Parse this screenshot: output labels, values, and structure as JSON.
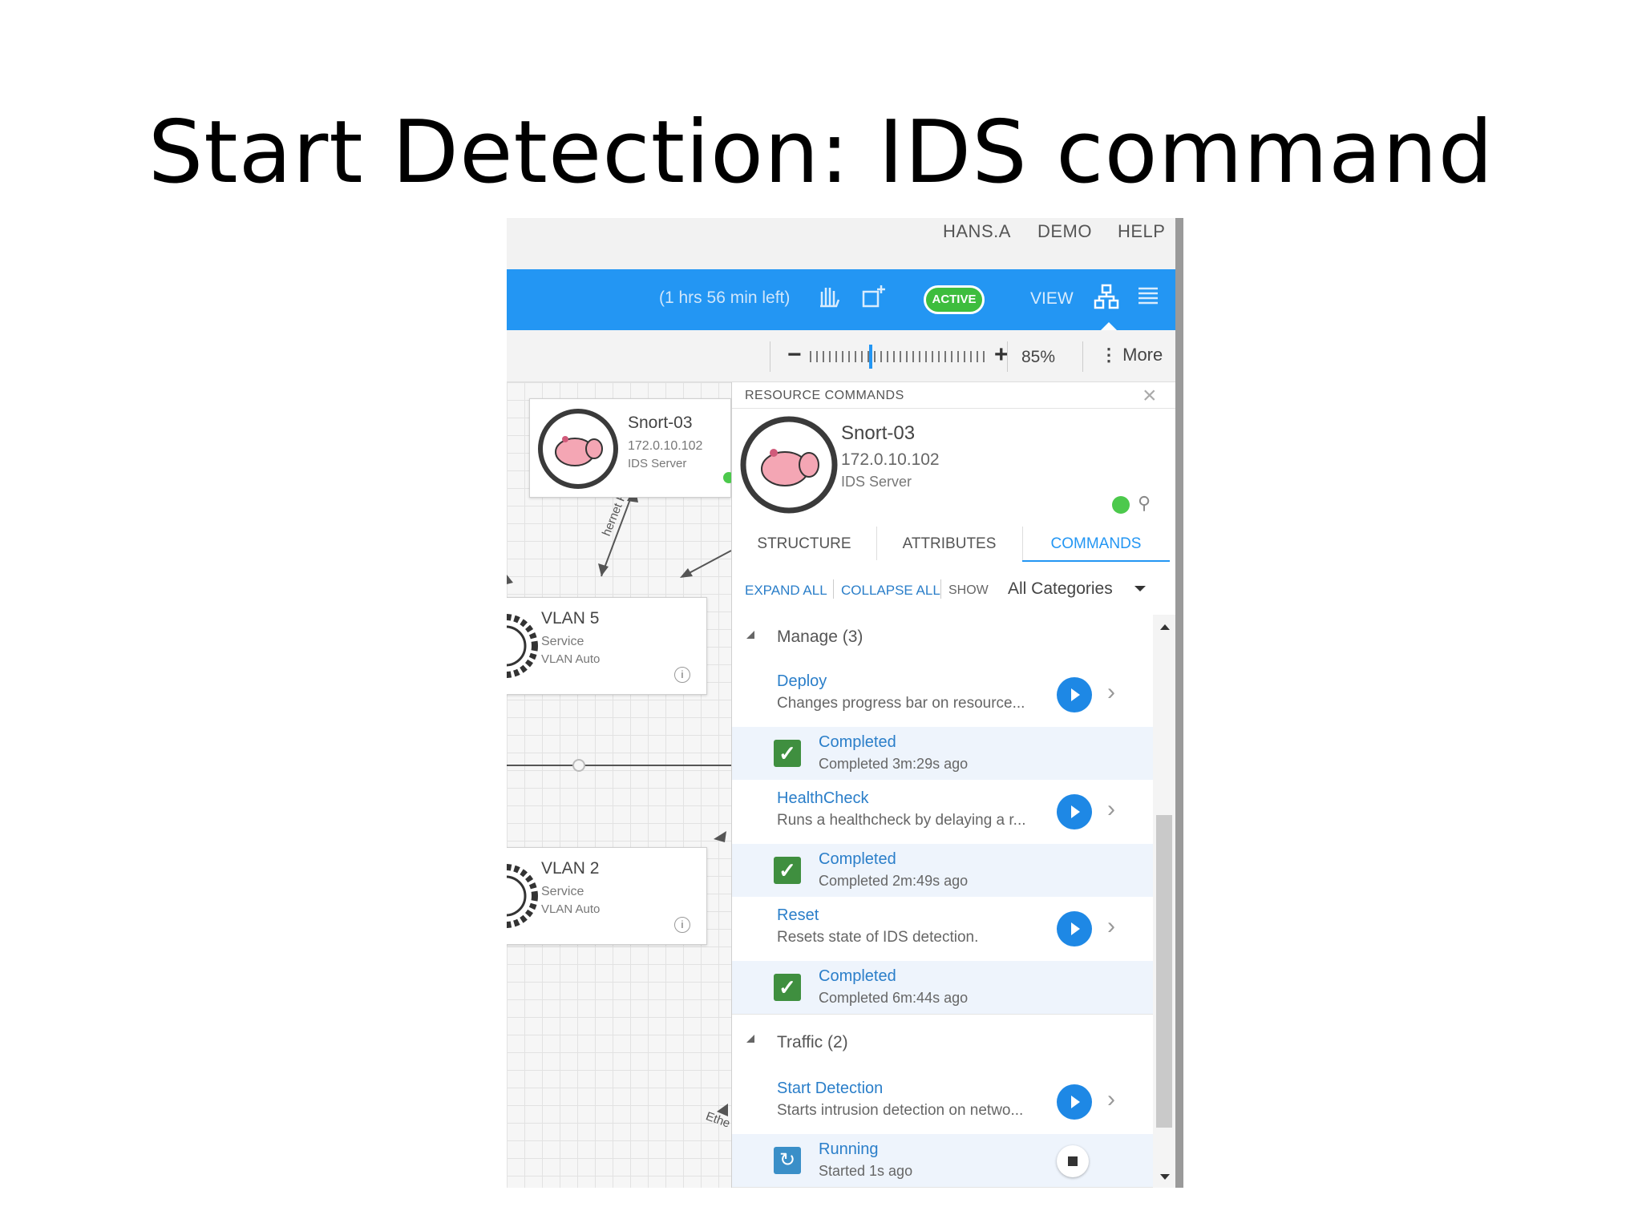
{
  "slide": {
    "title": "Start Detection: IDS command"
  },
  "topnav": {
    "user": "HANS.A",
    "demo": "DEMO",
    "help": "HELP"
  },
  "toolbar": {
    "time_left": "(1 hrs 56 min left)",
    "status": "ACTIVE",
    "view_label": "VIEW",
    "accent_color": "#2396f3"
  },
  "zoom": {
    "minus": "−",
    "plus": "+",
    "percent": "85%",
    "more": "More"
  },
  "canvas": {
    "snort_node": {
      "title": "Snort-03",
      "ip": "172.0.10.102",
      "type": "IDS Server"
    },
    "vlan5": {
      "title": "VLAN 5",
      "sub1": "Service",
      "sub2": "VLAN Auto"
    },
    "vlan2": {
      "title": "VLAN 2",
      "sub1": "Service",
      "sub2": "VLAN Auto"
    },
    "edge_label_1": "hernet Port",
    "edge_label_2": "Ethe"
  },
  "panel": {
    "header": "RESOURCE COMMANDS",
    "resource": {
      "name": "Snort-03",
      "ip": "172.0.10.102",
      "type": "IDS Server"
    },
    "tabs": [
      {
        "label": "STRUCTURE"
      },
      {
        "label": "ATTRIBUTES"
      },
      {
        "label": "COMMANDS"
      }
    ],
    "filter": {
      "expand_all": "EXPAND ALL",
      "collapse_all": "COLLAPSE ALL",
      "show": "SHOW",
      "category": "All Categories"
    },
    "groups": [
      {
        "label": "Manage (3)",
        "commands": [
          {
            "name": "Deploy",
            "desc": "Changes progress bar  on resource...",
            "status": "Completed",
            "time": "Completed 3m:29s ago"
          },
          {
            "name": "HealthCheck",
            "desc": "Runs a healthcheck by delaying a r...",
            "status": "Completed",
            "time": "Completed 2m:49s ago"
          },
          {
            "name": "Reset",
            "desc": "Resets state of IDS detection.",
            "status": "Completed",
            "time": "Completed 6m:44s ago"
          }
        ]
      },
      {
        "label": "Traffic (2)",
        "commands": [
          {
            "name": "Start Detection",
            "desc": "Starts intrusion detection on netwo...",
            "status": "Running",
            "time": "Started 1s ago"
          }
        ]
      }
    ]
  }
}
